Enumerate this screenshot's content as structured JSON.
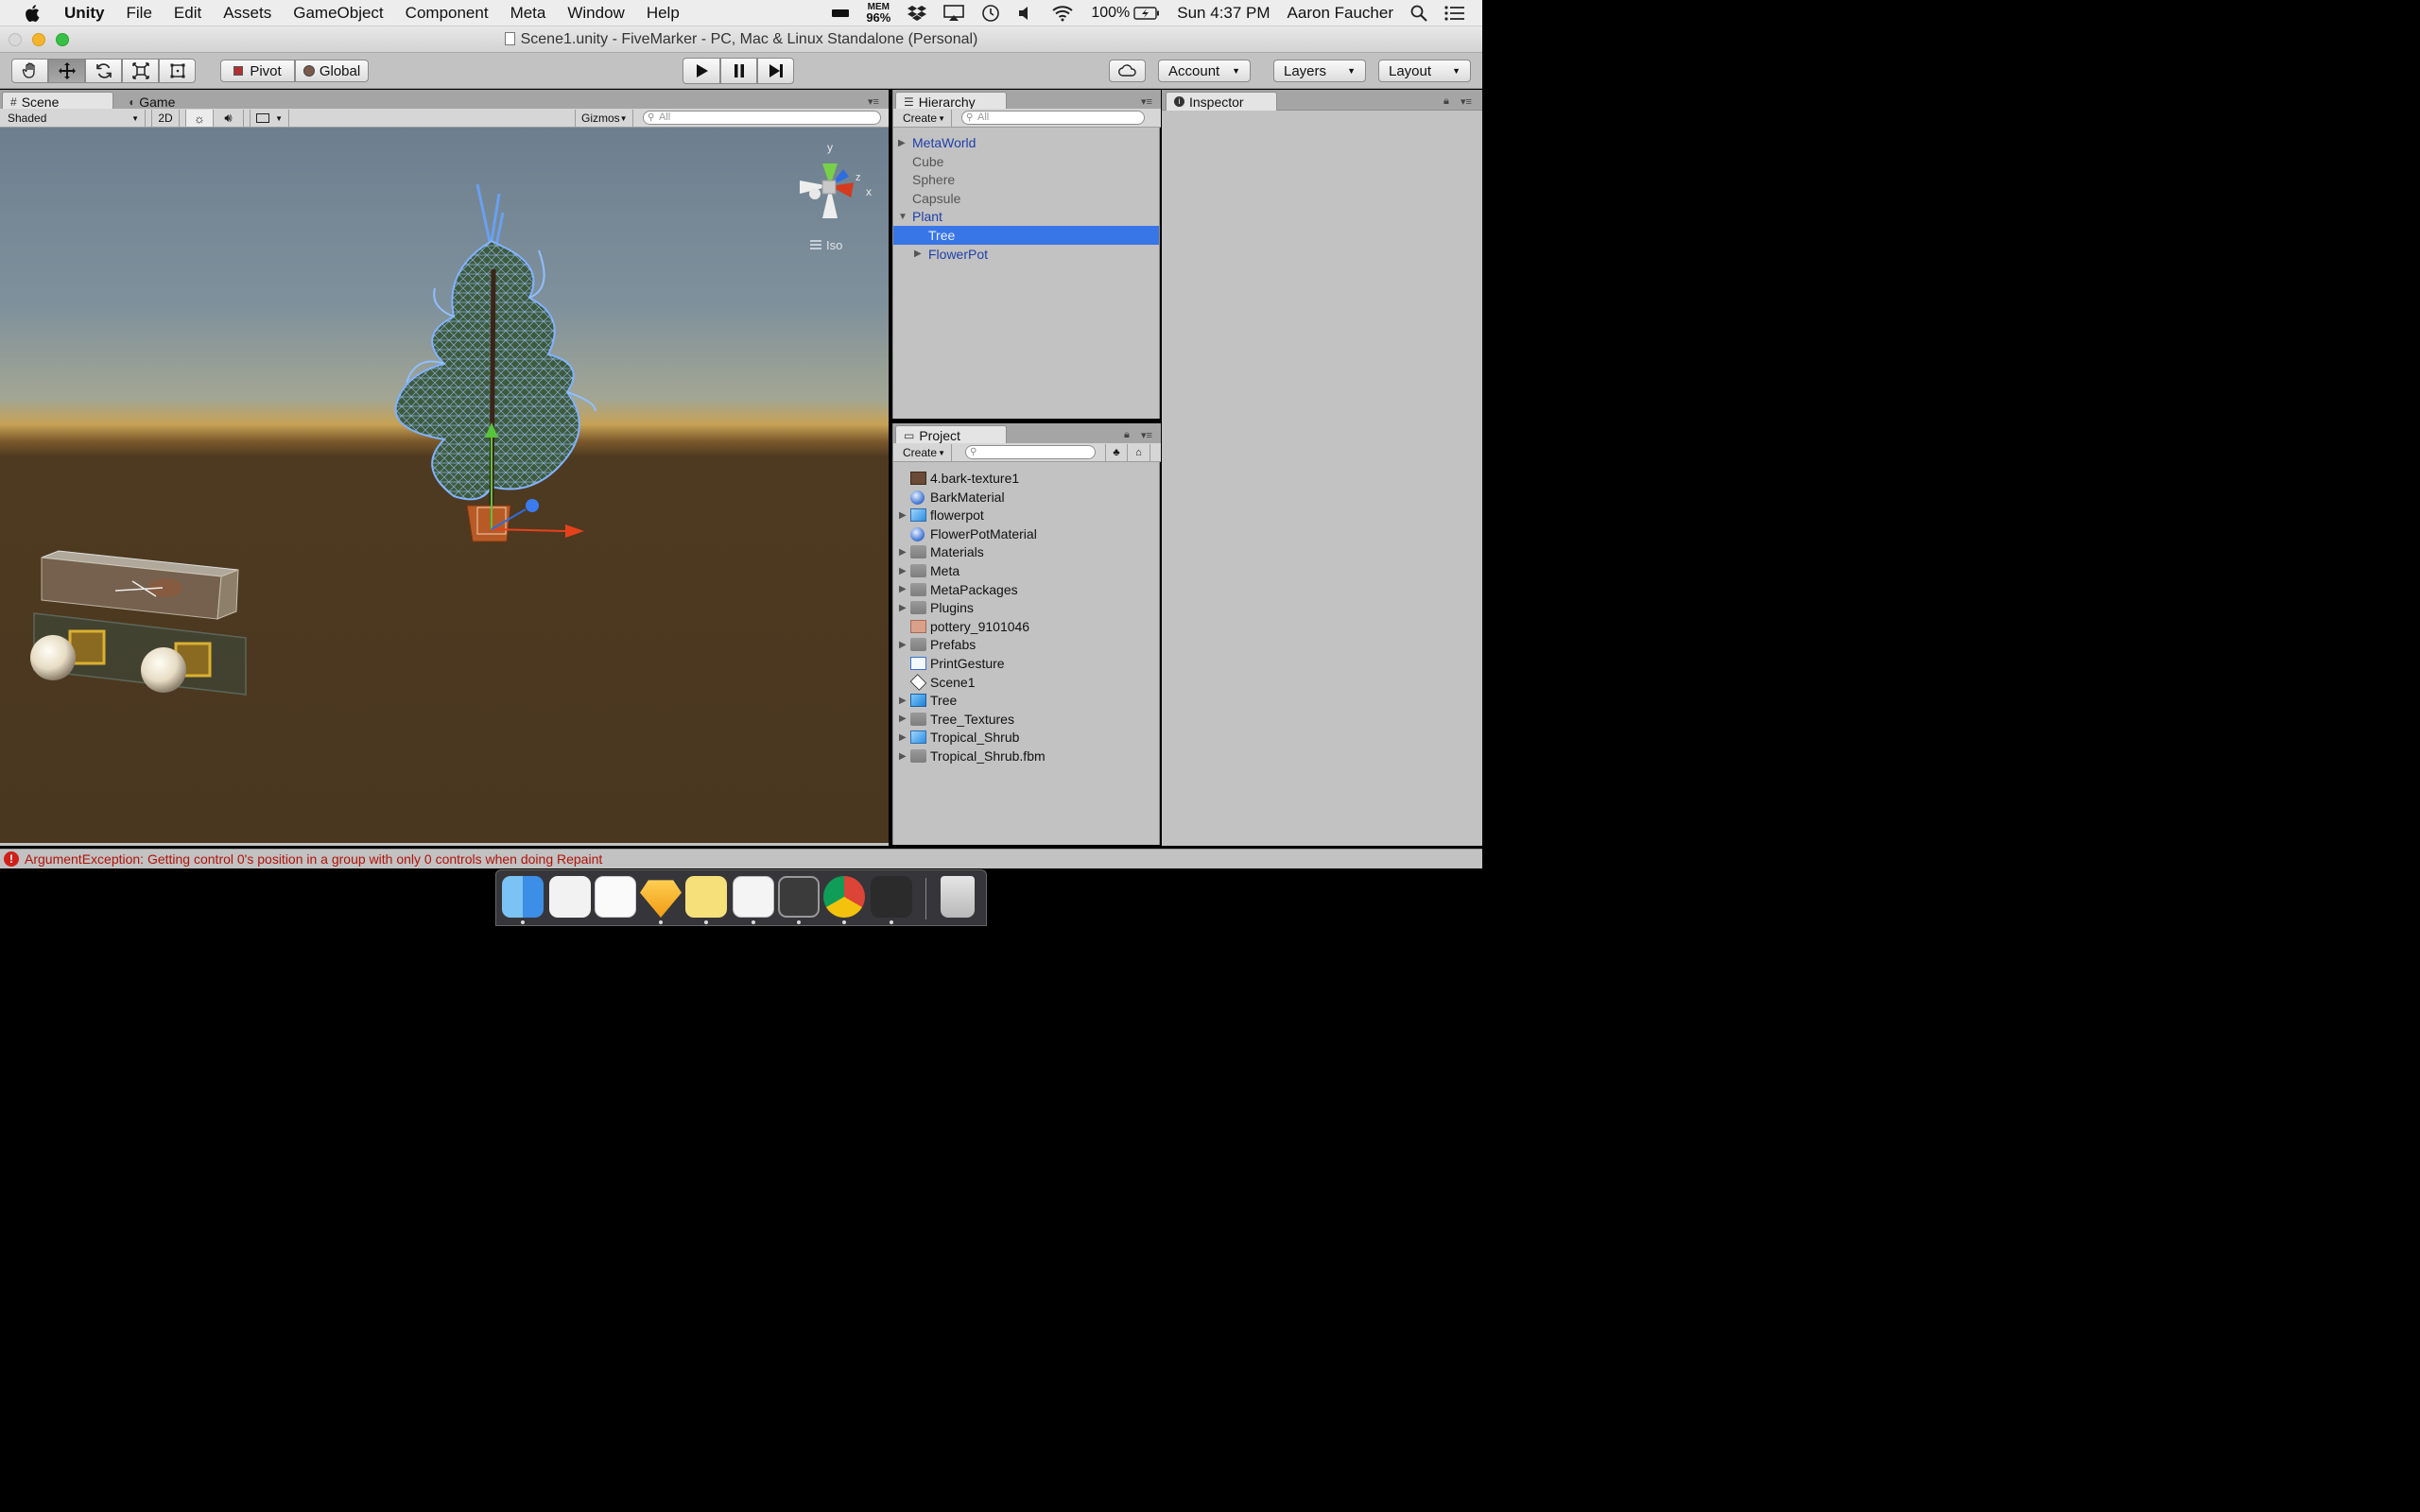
{
  "menubar": {
    "app_name": "Unity",
    "items": [
      "File",
      "Edit",
      "Assets",
      "GameObject",
      "Component",
      "Meta",
      "Window",
      "Help"
    ],
    "mem_label": "MEM",
    "mem_value": "96%",
    "battery": "100%",
    "clock": "Sun 4:37 PM",
    "user": "Aaron Faucher"
  },
  "window": {
    "title": "Scene1.unity - FiveMarker - PC, Mac & Linux Standalone (Personal)"
  },
  "toolbar": {
    "pivot_label": "Pivot",
    "global_label": "Global",
    "account_label": "Account",
    "layers_label": "Layers",
    "layout_label": "Layout"
  },
  "scene": {
    "tab_scene": "Scene",
    "tab_game": "Game",
    "shading": "Shaded",
    "mode_2d": "2D",
    "gizmos": "Gizmos",
    "search_placeholder": "All",
    "projection": "Iso",
    "axis_x": "x",
    "axis_y": "y",
    "axis_z": "z"
  },
  "hierarchy": {
    "tab": "Hierarchy",
    "create": "Create",
    "search_placeholder": "All",
    "items": [
      {
        "label": "MetaWorld",
        "depth": 0,
        "arrow": "right",
        "style": "blue"
      },
      {
        "label": "Cube",
        "depth": 0,
        "arrow": "",
        "style": "grey"
      },
      {
        "label": "Sphere",
        "depth": 0,
        "arrow": "",
        "style": "grey"
      },
      {
        "label": "Capsule",
        "depth": 0,
        "arrow": "",
        "style": "grey"
      },
      {
        "label": "Plant",
        "depth": 0,
        "arrow": "down",
        "style": "blue"
      },
      {
        "label": "Tree",
        "depth": 1,
        "arrow": "",
        "style": "selected"
      },
      {
        "label": "FlowerPot",
        "depth": 1,
        "arrow": "right",
        "style": "blue"
      }
    ]
  },
  "inspector": {
    "tab": "Inspector"
  },
  "project": {
    "tab": "Project",
    "create": "Create",
    "items": [
      {
        "label": "4.bark-texture1",
        "icon": "texture-icon",
        "arrow": false
      },
      {
        "label": "BarkMaterial",
        "icon": "material-icon",
        "arrow": false
      },
      {
        "label": "flowerpot",
        "icon": "model-icon",
        "arrow": true
      },
      {
        "label": "FlowerPotMaterial",
        "icon": "material-icon",
        "arrow": false
      },
      {
        "label": "Materials",
        "icon": "folder-icon",
        "arrow": true
      },
      {
        "label": "Meta",
        "icon": "folder-icon",
        "arrow": true
      },
      {
        "label": "MetaPackages",
        "icon": "folder-icon",
        "arrow": true
      },
      {
        "label": "Plugins",
        "icon": "folder-icon",
        "arrow": true
      },
      {
        "label": "pottery_9101046",
        "icon": "texture-pink-icon",
        "arrow": false
      },
      {
        "label": "Prefabs",
        "icon": "folder-icon",
        "arrow": true
      },
      {
        "label": "PrintGesture",
        "icon": "script-icon",
        "arrow": false
      },
      {
        "label": "Scene1",
        "icon": "unity-scene-icon",
        "arrow": false
      },
      {
        "label": "Tree",
        "icon": "prefab-icon",
        "arrow": true
      },
      {
        "label": "Tree_Textures",
        "icon": "folder-icon",
        "arrow": true
      },
      {
        "label": "Tropical_Shrub",
        "icon": "model-icon",
        "arrow": true
      },
      {
        "label": "Tropical_Shrub.fbm",
        "icon": "folder-icon",
        "arrow": true
      }
    ]
  },
  "status": {
    "message": "ArgumentException: Getting control 0's position in a group with only 0 controls when doing Repaint"
  },
  "dock": {
    "apps": [
      "finder-icon",
      "launchpad-icon",
      "reminders-icon",
      "sketch-icon",
      "stickies-icon",
      "textedit-icon",
      "sublime-text-icon",
      "chrome-icon",
      "unity-icon",
      "trash-icon"
    ]
  },
  "colors": {
    "selection": "#3876e8",
    "link_blue": "#1f3fa8",
    "error_red": "#b0120a",
    "panel_grey": "#c2c2c2"
  }
}
